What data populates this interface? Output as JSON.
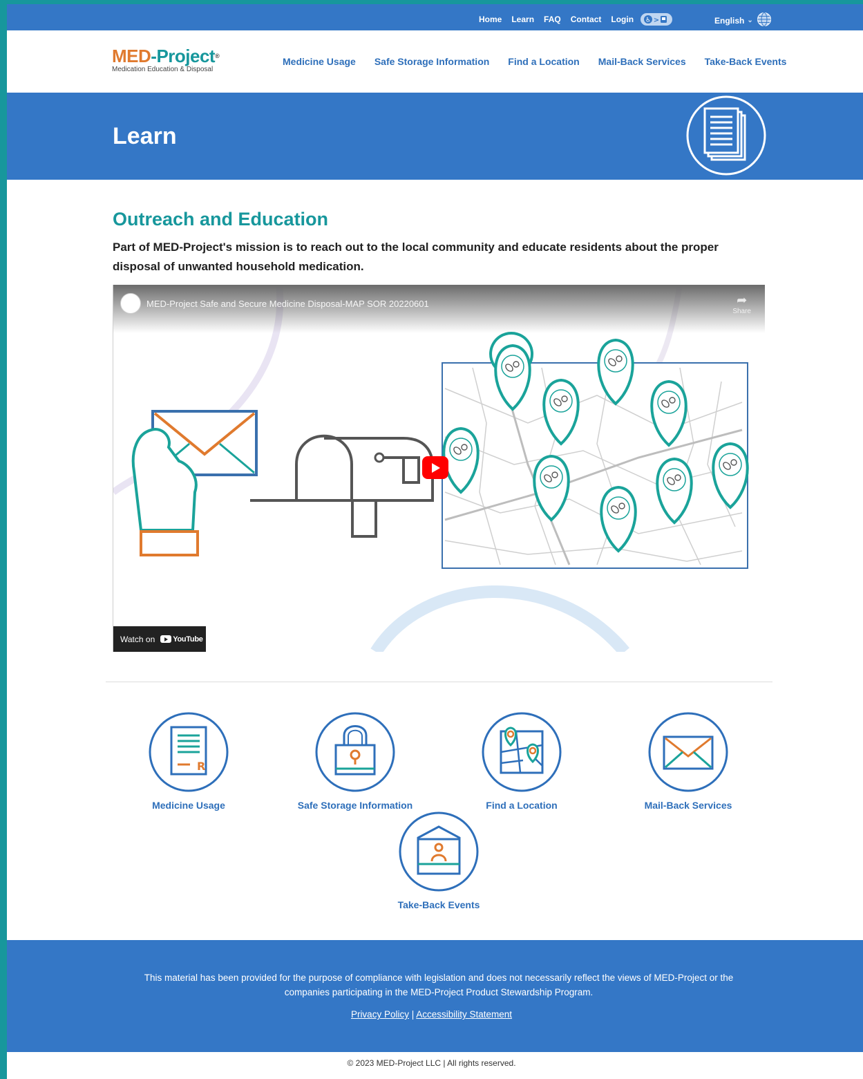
{
  "utility": {
    "links": [
      "Home",
      "Learn",
      "FAQ",
      "Contact",
      "Login"
    ],
    "language": "English"
  },
  "logo": {
    "name_part1": "MED",
    "name_part2": "-Project",
    "reg": "®",
    "subtitle": "Medication Education & Disposal"
  },
  "nav": {
    "items": [
      "Medicine Usage",
      "Safe Storage Information",
      "Find a Location",
      "Mail-Back Services",
      "Take-Back Events"
    ]
  },
  "hero": {
    "title": "Learn"
  },
  "main": {
    "section_title": "Outreach and Education",
    "intro": "Part of MED-Project's mission is to reach out to the local community and educate residents about the proper disposal of unwanted household medication."
  },
  "video": {
    "title": "MED-Project Safe and Secure Medicine Disposal-MAP SOR 20220601",
    "share_label": "Share",
    "watch_on": "Watch on",
    "youtube_label": "YouTube"
  },
  "cards": [
    {
      "label": "Medicine Usage",
      "icon": "prescription-document-icon"
    },
    {
      "label": "Safe Storage Information",
      "icon": "padlock-icon"
    },
    {
      "label": "Find a Location",
      "icon": "map-pins-icon"
    },
    {
      "label": "Mail-Back Services",
      "icon": "envelope-icon"
    },
    {
      "label": "Take-Back Events",
      "icon": "kiosk-person-icon"
    }
  ],
  "footer": {
    "disclaimer": "This material has been provided for the purpose of compliance with legislation and does not necessarily reflect the views of MED-Project or the companies participating in the MED-Project Product Stewardship Program.",
    "privacy": "Privacy Policy",
    "separator": " | ",
    "accessibility": "Accessibility Statement",
    "copyright": "© 2023 MED-Project LLC | All rights reserved."
  },
  "colors": {
    "brand_blue": "#3477c6",
    "teal": "#17979c",
    "orange": "#e07a2e",
    "link_blue": "#2e6fba"
  }
}
